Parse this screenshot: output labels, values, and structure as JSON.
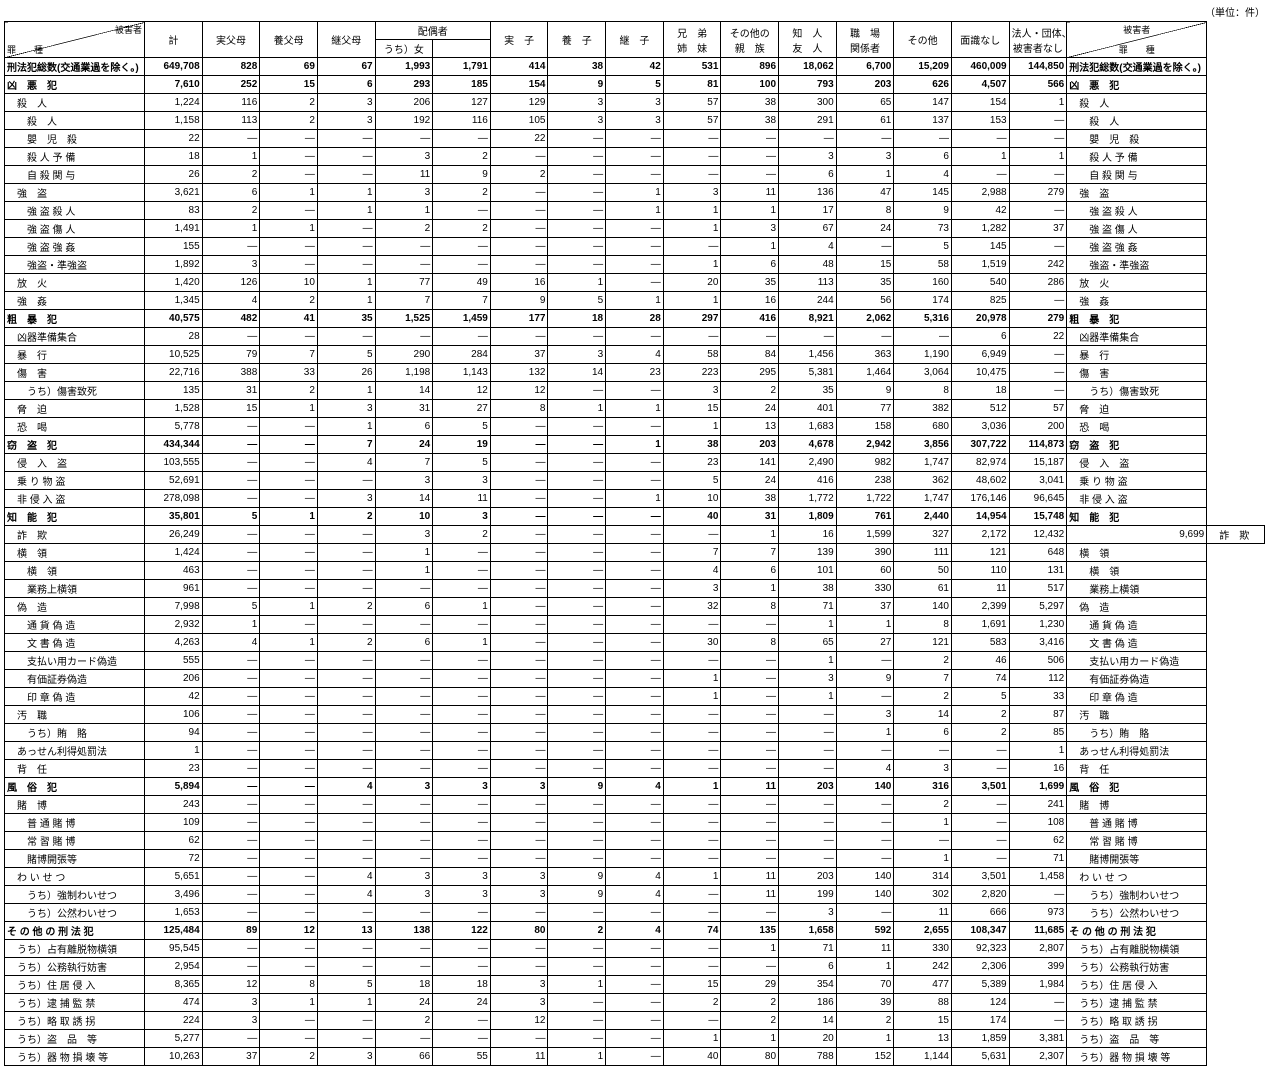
{
  "unit": "（単位：件）",
  "diagLeft": {
    "top": "被害者",
    "bottom": "罪　　種"
  },
  "diagRight": {
    "top": "被害者",
    "bottom": "罪　　種"
  },
  "headers": [
    "計",
    "実父母",
    "養父母",
    "継父母",
    "配偶者",
    "うち）女",
    "実　子",
    "養　子",
    "継　子",
    "兄　弟\n姉　妹",
    "その他の\n親　族",
    "知　人\n友　人",
    "職　場\n関係者",
    "その他",
    "面識なし",
    "法人・団体、\n被害者なし"
  ],
  "rows": [
    {
      "b": 1,
      "l": "刑法犯総数(交通業過を除く。)",
      "v": [
        "649,708",
        "828",
        "69",
        "67",
        "1,993",
        "1,791",
        "414",
        "38",
        "42",
        "531",
        "896",
        "18,062",
        "6,700",
        "15,209",
        "460,009",
        "144,850"
      ]
    },
    {
      "b": 1,
      "l": "凶　悪　犯",
      "jl": 1,
      "v": [
        "7,610",
        "252",
        "15",
        "6",
        "293",
        "185",
        "154",
        "9",
        "5",
        "81",
        "100",
        "793",
        "203",
        "626",
        "4,507",
        "566"
      ]
    },
    {
      "l": "　殺　人",
      "jl": 1,
      "v": [
        "1,224",
        "116",
        "2",
        "3",
        "206",
        "127",
        "129",
        "3",
        "3",
        "57",
        "38",
        "300",
        "65",
        "147",
        "154",
        "1"
      ]
    },
    {
      "l": "　　殺　人",
      "jl": 1,
      "v": [
        "1,158",
        "113",
        "2",
        "3",
        "192",
        "116",
        "105",
        "3",
        "3",
        "57",
        "38",
        "291",
        "61",
        "137",
        "153",
        "—"
      ]
    },
    {
      "l": "　　嬰　児　殺",
      "jl": 1,
      "v": [
        "22",
        "—",
        "—",
        "—",
        "—",
        "—",
        "22",
        "—",
        "—",
        "—",
        "—",
        "—",
        "—",
        "—",
        "—",
        "—"
      ]
    },
    {
      "l": "　　殺 人 予 備",
      "jl": 1,
      "v": [
        "18",
        "1",
        "—",
        "—",
        "3",
        "2",
        "—",
        "—",
        "—",
        "—",
        "—",
        "3",
        "3",
        "6",
        "1",
        "1"
      ]
    },
    {
      "l": "　　自 殺 関 与",
      "jl": 1,
      "v": [
        "26",
        "2",
        "—",
        "—",
        "11",
        "9",
        "2",
        "—",
        "—",
        "—",
        "—",
        "6",
        "1",
        "4",
        "—",
        "—"
      ]
    },
    {
      "l": "　強　盗",
      "jl": 1,
      "v": [
        "3,621",
        "6",
        "1",
        "1",
        "3",
        "2",
        "—",
        "—",
        "1",
        "3",
        "11",
        "136",
        "47",
        "145",
        "2,988",
        "279"
      ]
    },
    {
      "l": "　　強 盗 殺 人",
      "jl": 1,
      "v": [
        "83",
        "2",
        "—",
        "1",
        "1",
        "—",
        "—",
        "—",
        "1",
        "1",
        "1",
        "17",
        "8",
        "9",
        "42",
        "—"
      ]
    },
    {
      "l": "　　強 盗 傷 人",
      "jl": 1,
      "v": [
        "1,491",
        "1",
        "1",
        "—",
        "2",
        "2",
        "—",
        "—",
        "—",
        "1",
        "3",
        "67",
        "24",
        "73",
        "1,282",
        "37"
      ]
    },
    {
      "l": "　　強 盗 強 姦",
      "jl": 1,
      "v": [
        "155",
        "—",
        "—",
        "—",
        "—",
        "—",
        "—",
        "—",
        "—",
        "—",
        "1",
        "4",
        "—",
        "5",
        "145",
        "—"
      ]
    },
    {
      "l": "　　強盗・準強盗",
      "jl": 1,
      "v": [
        "1,892",
        "3",
        "—",
        "—",
        "—",
        "—",
        "—",
        "—",
        "—",
        "1",
        "6",
        "48",
        "15",
        "58",
        "1,519",
        "242"
      ]
    },
    {
      "l": "　放　火",
      "jl": 1,
      "v": [
        "1,420",
        "126",
        "10",
        "1",
        "77",
        "49",
        "16",
        "1",
        "—",
        "20",
        "35",
        "113",
        "35",
        "160",
        "540",
        "286"
      ]
    },
    {
      "l": "　強　姦",
      "jl": 1,
      "v": [
        "1,345",
        "4",
        "2",
        "1",
        "7",
        "7",
        "9",
        "5",
        "1",
        "1",
        "16",
        "244",
        "56",
        "174",
        "825",
        "—"
      ]
    },
    {
      "b": 1,
      "l": "粗　暴　犯",
      "jl": 1,
      "v": [
        "40,575",
        "482",
        "41",
        "35",
        "1,525",
        "1,459",
        "177",
        "18",
        "28",
        "297",
        "416",
        "8,921",
        "2,062",
        "5,316",
        "20,978",
        "279"
      ]
    },
    {
      "l": "　凶器準備集合",
      "jl": 1,
      "v": [
        "28",
        "—",
        "—",
        "—",
        "—",
        "—",
        "—",
        "—",
        "—",
        "—",
        "—",
        "—",
        "—",
        "—",
        "6",
        "22"
      ]
    },
    {
      "l": "　暴　行",
      "jl": 1,
      "v": [
        "10,525",
        "79",
        "7",
        "5",
        "290",
        "284",
        "37",
        "3",
        "4",
        "58",
        "84",
        "1,456",
        "363",
        "1,190",
        "6,949",
        "—"
      ]
    },
    {
      "l": "　傷　害",
      "jl": 1,
      "v": [
        "22,716",
        "388",
        "33",
        "26",
        "1,198",
        "1,143",
        "132",
        "14",
        "23",
        "223",
        "295",
        "5,381",
        "1,464",
        "3,064",
        "10,475",
        "—"
      ]
    },
    {
      "l": "　　うち）傷害致死",
      "v": [
        "135",
        "31",
        "2",
        "1",
        "14",
        "12",
        "12",
        "—",
        "—",
        "3",
        "2",
        "35",
        "9",
        "8",
        "18",
        "—"
      ]
    },
    {
      "l": "　脅　迫",
      "jl": 1,
      "v": [
        "1,528",
        "15",
        "1",
        "3",
        "31",
        "27",
        "8",
        "1",
        "1",
        "15",
        "24",
        "401",
        "77",
        "382",
        "512",
        "57"
      ]
    },
    {
      "l": "　恐　喝",
      "jl": 1,
      "v": [
        "5,778",
        "—",
        "—",
        "1",
        "6",
        "5",
        "—",
        "—",
        "—",
        "1",
        "13",
        "1,683",
        "158",
        "680",
        "3,036",
        "200"
      ]
    },
    {
      "b": 1,
      "l": "窃　盗　犯",
      "jl": 1,
      "v": [
        "434,344",
        "—",
        "—",
        "7",
        "24",
        "19",
        "—",
        "—",
        "1",
        "38",
        "203",
        "4,678",
        "2,942",
        "3,856",
        "307,722",
        "114,873"
      ]
    },
    {
      "l": "　侵　入　盗",
      "jl": 1,
      "v": [
        "103,555",
        "—",
        "—",
        "4",
        "7",
        "5",
        "—",
        "—",
        "—",
        "23",
        "141",
        "2,490",
        "982",
        "1,747",
        "82,974",
        "15,187"
      ]
    },
    {
      "l": "　乗 り 物 盗",
      "jl": 1,
      "v": [
        "52,691",
        "—",
        "—",
        "—",
        "3",
        "3",
        "—",
        "—",
        "—",
        "5",
        "24",
        "416",
        "238",
        "362",
        "48,602",
        "3,041"
      ]
    },
    {
      "l": "　非 侵 入 盗",
      "jl": 1,
      "v": [
        "278,098",
        "—",
        "—",
        "3",
        "14",
        "11",
        "—",
        "—",
        "1",
        "10",
        "38",
        "1,772",
        "1,722",
        "1,747",
        "176,146",
        "96,645"
      ]
    },
    {
      "b": 1,
      "l": "知　能　犯",
      "jl": 1,
      "v": [
        "35,801",
        "5",
        "1",
        "2",
        "10",
        "3",
        "—",
        "—",
        "—",
        "40",
        "31",
        "1,809",
        "761",
        "2,440",
        "14,954",
        "15,748"
      ]
    },
    {
      "l": "　詐　欺",
      "jl": 1,
      "v": [
        "26,249",
        "—",
        "—",
        "—",
        "3",
        "2",
        "—",
        "—",
        "—",
        "—",
        "1",
        "16",
        "1,599",
        "327",
        "2,172",
        "12,432",
        "9,699"
      ]
    },
    {
      "l": "　横　領",
      "jl": 1,
      "v": [
        "1,424",
        "—",
        "—",
        "—",
        "1",
        "—",
        "—",
        "—",
        "—",
        "7",
        "7",
        "139",
        "390",
        "111",
        "121",
        "648"
      ]
    },
    {
      "l": "　　横　領",
      "jl": 1,
      "v": [
        "463",
        "—",
        "—",
        "—",
        "1",
        "—",
        "—",
        "—",
        "—",
        "4",
        "6",
        "101",
        "60",
        "50",
        "110",
        "131"
      ]
    },
    {
      "l": "　　業務上横領",
      "jl": 1,
      "v": [
        "961",
        "—",
        "—",
        "—",
        "—",
        "—",
        "—",
        "—",
        "—",
        "3",
        "1",
        "38",
        "330",
        "61",
        "11",
        "517"
      ]
    },
    {
      "l": "　偽　造",
      "jl": 1,
      "v": [
        "7,998",
        "5",
        "1",
        "2",
        "6",
        "1",
        "—",
        "—",
        "—",
        "32",
        "8",
        "71",
        "37",
        "140",
        "2,399",
        "5,297"
      ]
    },
    {
      "l": "　　通 貨 偽 造",
      "jl": 1,
      "v": [
        "2,932",
        "1",
        "—",
        "—",
        "—",
        "—",
        "—",
        "—",
        "—",
        "—",
        "—",
        "1",
        "1",
        "8",
        "1,691",
        "1,230"
      ]
    },
    {
      "l": "　　文 書 偽 造",
      "jl": 1,
      "v": [
        "4,263",
        "4",
        "1",
        "2",
        "6",
        "1",
        "—",
        "—",
        "—",
        "30",
        "8",
        "65",
        "27",
        "121",
        "583",
        "3,416"
      ]
    },
    {
      "l": "　　支払い用カード偽造",
      "v": [
        "555",
        "—",
        "—",
        "—",
        "—",
        "—",
        "—",
        "—",
        "—",
        "—",
        "—",
        "1",
        "—",
        "2",
        "46",
        "506"
      ]
    },
    {
      "l": "　　有価証券偽造",
      "jl": 1,
      "v": [
        "206",
        "—",
        "—",
        "—",
        "—",
        "—",
        "—",
        "—",
        "—",
        "1",
        "—",
        "3",
        "9",
        "7",
        "74",
        "112"
      ]
    },
    {
      "l": "　　印 章 偽 造",
      "jl": 1,
      "v": [
        "42",
        "—",
        "—",
        "—",
        "—",
        "—",
        "—",
        "—",
        "—",
        "1",
        "—",
        "1",
        "—",
        "2",
        "5",
        "33"
      ]
    },
    {
      "l": "　汚　職",
      "jl": 1,
      "v": [
        "106",
        "—",
        "—",
        "—",
        "—",
        "—",
        "—",
        "—",
        "—",
        "—",
        "—",
        "—",
        "3",
        "14",
        "2",
        "87"
      ]
    },
    {
      "l": "　　うち）賄　賂",
      "jl": 1,
      "v": [
        "94",
        "—",
        "—",
        "—",
        "—",
        "—",
        "—",
        "—",
        "—",
        "—",
        "—",
        "—",
        "1",
        "6",
        "2",
        "85"
      ]
    },
    {
      "l": "　あっせん利得処罰法",
      "v": [
        "1",
        "—",
        "—",
        "—",
        "—",
        "—",
        "—",
        "—",
        "—",
        "—",
        "—",
        "—",
        "—",
        "—",
        "—",
        "1"
      ]
    },
    {
      "l": "　背　任",
      "jl": 1,
      "v": [
        "23",
        "—",
        "—",
        "—",
        "—",
        "—",
        "—",
        "—",
        "—",
        "—",
        "—",
        "—",
        "4",
        "3",
        "—",
        "16"
      ]
    },
    {
      "b": 1,
      "l": "風　俗　犯",
      "jl": 1,
      "v": [
        "5,894",
        "—",
        "—",
        "4",
        "3",
        "3",
        "3",
        "9",
        "4",
        "1",
        "11",
        "203",
        "140",
        "316",
        "3,501",
        "1,699"
      ]
    },
    {
      "l": "　賭　博",
      "jl": 1,
      "v": [
        "243",
        "—",
        "—",
        "—",
        "—",
        "—",
        "—",
        "—",
        "—",
        "—",
        "—",
        "—",
        "—",
        "2",
        "—",
        "241"
      ]
    },
    {
      "l": "　　普 通 賭 博",
      "jl": 1,
      "v": [
        "109",
        "—",
        "—",
        "—",
        "—",
        "—",
        "—",
        "—",
        "—",
        "—",
        "—",
        "—",
        "—",
        "1",
        "—",
        "108"
      ]
    },
    {
      "l": "　　常 習 賭 博",
      "jl": 1,
      "v": [
        "62",
        "—",
        "—",
        "—",
        "—",
        "—",
        "—",
        "—",
        "—",
        "—",
        "—",
        "—",
        "—",
        "—",
        "—",
        "62"
      ]
    },
    {
      "l": "　　賭博開張等",
      "jl": 1,
      "v": [
        "72",
        "—",
        "—",
        "—",
        "—",
        "—",
        "—",
        "—",
        "—",
        "—",
        "—",
        "—",
        "—",
        "1",
        "—",
        "71"
      ]
    },
    {
      "l": "　わ い せ つ",
      "jl": 1,
      "v": [
        "5,651",
        "—",
        "—",
        "4",
        "3",
        "3",
        "3",
        "9",
        "4",
        "1",
        "11",
        "203",
        "140",
        "314",
        "3,501",
        "1,458"
      ]
    },
    {
      "l": "　　うち）強制わいせつ",
      "v": [
        "3,496",
        "—",
        "—",
        "4",
        "3",
        "3",
        "3",
        "9",
        "4",
        "—",
        "11",
        "199",
        "140",
        "302",
        "2,820",
        "—"
      ]
    },
    {
      "l": "　　うち）公然わいせつ",
      "v": [
        "1,653",
        "—",
        "—",
        "—",
        "—",
        "—",
        "—",
        "—",
        "—",
        "—",
        "—",
        "3",
        "—",
        "11",
        "666",
        "973"
      ]
    },
    {
      "b": 1,
      "l": "そ の 他 の 刑 法 犯",
      "jl": 1,
      "v": [
        "125,484",
        "89",
        "12",
        "13",
        "138",
        "122",
        "80",
        "2",
        "4",
        "74",
        "135",
        "1,658",
        "592",
        "2,655",
        "108,347",
        "11,685"
      ]
    },
    {
      "l": "　うち）占有離脱物横領",
      "v": [
        "95,545",
        "—",
        "—",
        "—",
        "—",
        "—",
        "—",
        "—",
        "—",
        "—",
        "1",
        "71",
        "11",
        "330",
        "92,323",
        "2,807"
      ]
    },
    {
      "l": "　うち）公務執行妨害",
      "v": [
        "2,954",
        "—",
        "—",
        "—",
        "—",
        "—",
        "—",
        "—",
        "—",
        "—",
        "—",
        "6",
        "1",
        "242",
        "2,306",
        "399"
      ]
    },
    {
      "l": "　うち）住 居 侵 入",
      "jl": 1,
      "v": [
        "8,365",
        "12",
        "8",
        "5",
        "18",
        "18",
        "3",
        "1",
        "—",
        "15",
        "29",
        "354",
        "70",
        "477",
        "5,389",
        "1,984"
      ]
    },
    {
      "l": "　うち）逮 捕 監 禁",
      "jl": 1,
      "v": [
        "474",
        "3",
        "1",
        "1",
        "24",
        "24",
        "3",
        "—",
        "—",
        "2",
        "2",
        "186",
        "39",
        "88",
        "124",
        "—"
      ]
    },
    {
      "l": "　うち）略 取 誘 拐",
      "jl": 1,
      "v": [
        "224",
        "3",
        "—",
        "—",
        "2",
        "—",
        "12",
        "—",
        "—",
        "—",
        "2",
        "14",
        "2",
        "15",
        "174",
        "—"
      ]
    },
    {
      "l": "　うち）盗　品　等",
      "jl": 1,
      "v": [
        "5,277",
        "—",
        "—",
        "—",
        "—",
        "—",
        "—",
        "—",
        "—",
        "1",
        "1",
        "20",
        "1",
        "13",
        "1,859",
        "3,381"
      ]
    },
    {
      "l": "　うち）器 物 損 壊 等",
      "v": [
        "10,263",
        "37",
        "2",
        "3",
        "66",
        "55",
        "11",
        "1",
        "—",
        "40",
        "80",
        "788",
        "152",
        "1,144",
        "5,631",
        "2,307"
      ]
    }
  ]
}
